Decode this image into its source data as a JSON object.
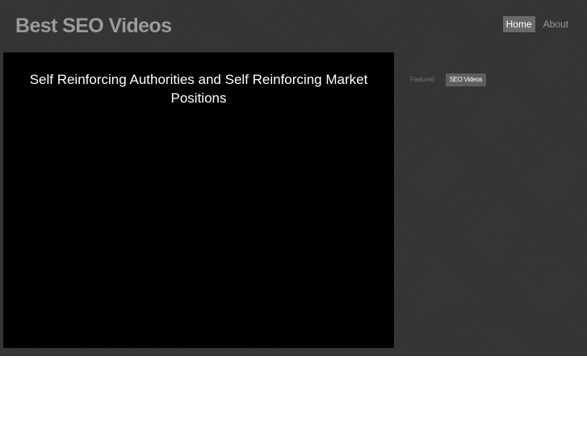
{
  "site": {
    "title": "Best SEO Videos"
  },
  "nav": {
    "items": [
      {
        "label": "Home",
        "active": true
      },
      {
        "label": "About",
        "active": false
      }
    ]
  },
  "video": {
    "title": "Self Reinforcing Authorities and Self Reinforcing Market Positions"
  },
  "tags": {
    "items": [
      {
        "label": "Featured",
        "active": false
      },
      {
        "label": "SEO Videos",
        "active": true
      }
    ]
  },
  "colors": {
    "background": "#343434",
    "video_background": "#000000",
    "title_text": "#9a9a9a",
    "active_nav_bg": "#6a6a6a",
    "active_tag_bg": "#5e5e5e"
  }
}
